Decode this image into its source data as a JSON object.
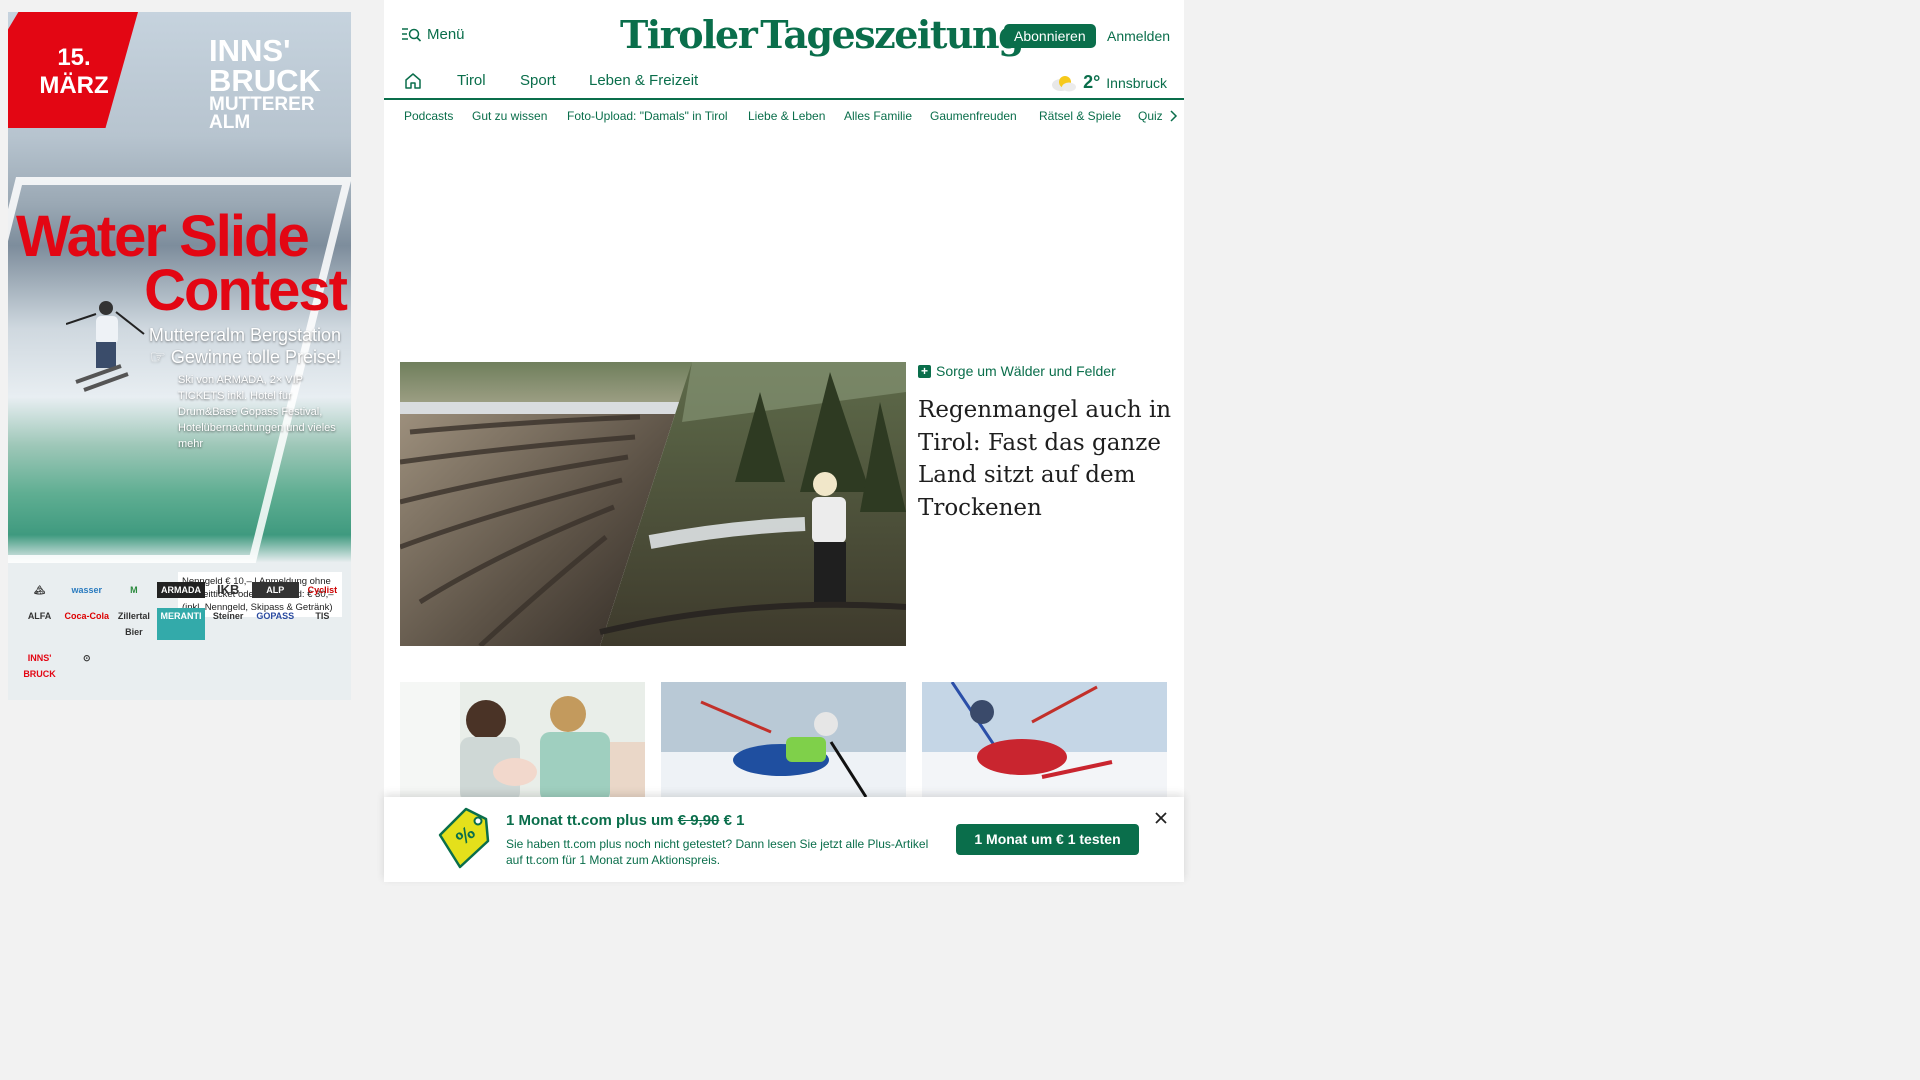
{
  "ad": {
    "date": "15.\nMÄRZ",
    "location_big": "INNS'\nBRUCK",
    "location_small": "MUTTERER\nALM",
    "title_line1": "Water Slide",
    "title_line2": "Contest",
    "subtitle": "Muttereralm Bergstation",
    "subtitle2": "Gewinne tolle Preise!",
    "prizes": "Ski von ARMADA, 2× VIP TICKETS inkl. Hotel für Drum&Base Gopass Festival, Hotelübernachtungen und vieles mehr",
    "price_info": "Nenngeld € 10,– | Anmeldung ohne Freizeitticket oder Snowcard: € 30,– (inkl. Nenngeld, Skipass & Getränk)",
    "sponsors": [
      "🏔",
      "wasser",
      "M",
      "ARMADA",
      "IKB",
      "ALP",
      "Cyclist",
      "ALFA",
      "Coca-Cola",
      "Zillertal Bier",
      "MERANTI",
      "Steiner",
      "GOPASS",
      "TIS",
      "INNS' BRUCK",
      "⊙"
    ]
  },
  "header": {
    "menu_label": "Menü",
    "logo_left": "Tiroler",
    "logo_right": "Tageszeitung",
    "subscribe_label": "Abonnieren",
    "login_label": "Anmelden"
  },
  "nav": {
    "items": [
      "Tirol",
      "Sport",
      "Leben & Freizeit"
    ],
    "weather": {
      "temp": "2°",
      "city": "Innsbruck"
    }
  },
  "subnav": {
    "items": [
      "Podcasts",
      "Gut zu wissen",
      "Foto-Upload: \"Damals\" in Tirol",
      "Liebe & Leben",
      "Alles Familie",
      "Gaumenfreuden",
      "Rätsel & Spiele",
      "Quiz"
    ]
  },
  "hero": {
    "kicker": "Sorge um Wälder und Felder",
    "plus_symbol": "+",
    "title": "Regenmangel auch in Tirol: Fast das ganze Land sitzt auf dem Trockenen"
  },
  "promo": {
    "headline_pre": "1 Monat tt.com plus um ",
    "old_price": "€ 9,90",
    "new_price": " € 1",
    "text": "Sie haben tt.com plus noch nicht getestet? Dann lesen Sie jetzt alle Plus-Artikel auf tt.com für 1 Monat zum Aktionspreis.",
    "cta_label": "1 Monat um € 1 testen"
  },
  "colors": {
    "brand": "#0a6e4b",
    "ad_red": "#e30613"
  }
}
